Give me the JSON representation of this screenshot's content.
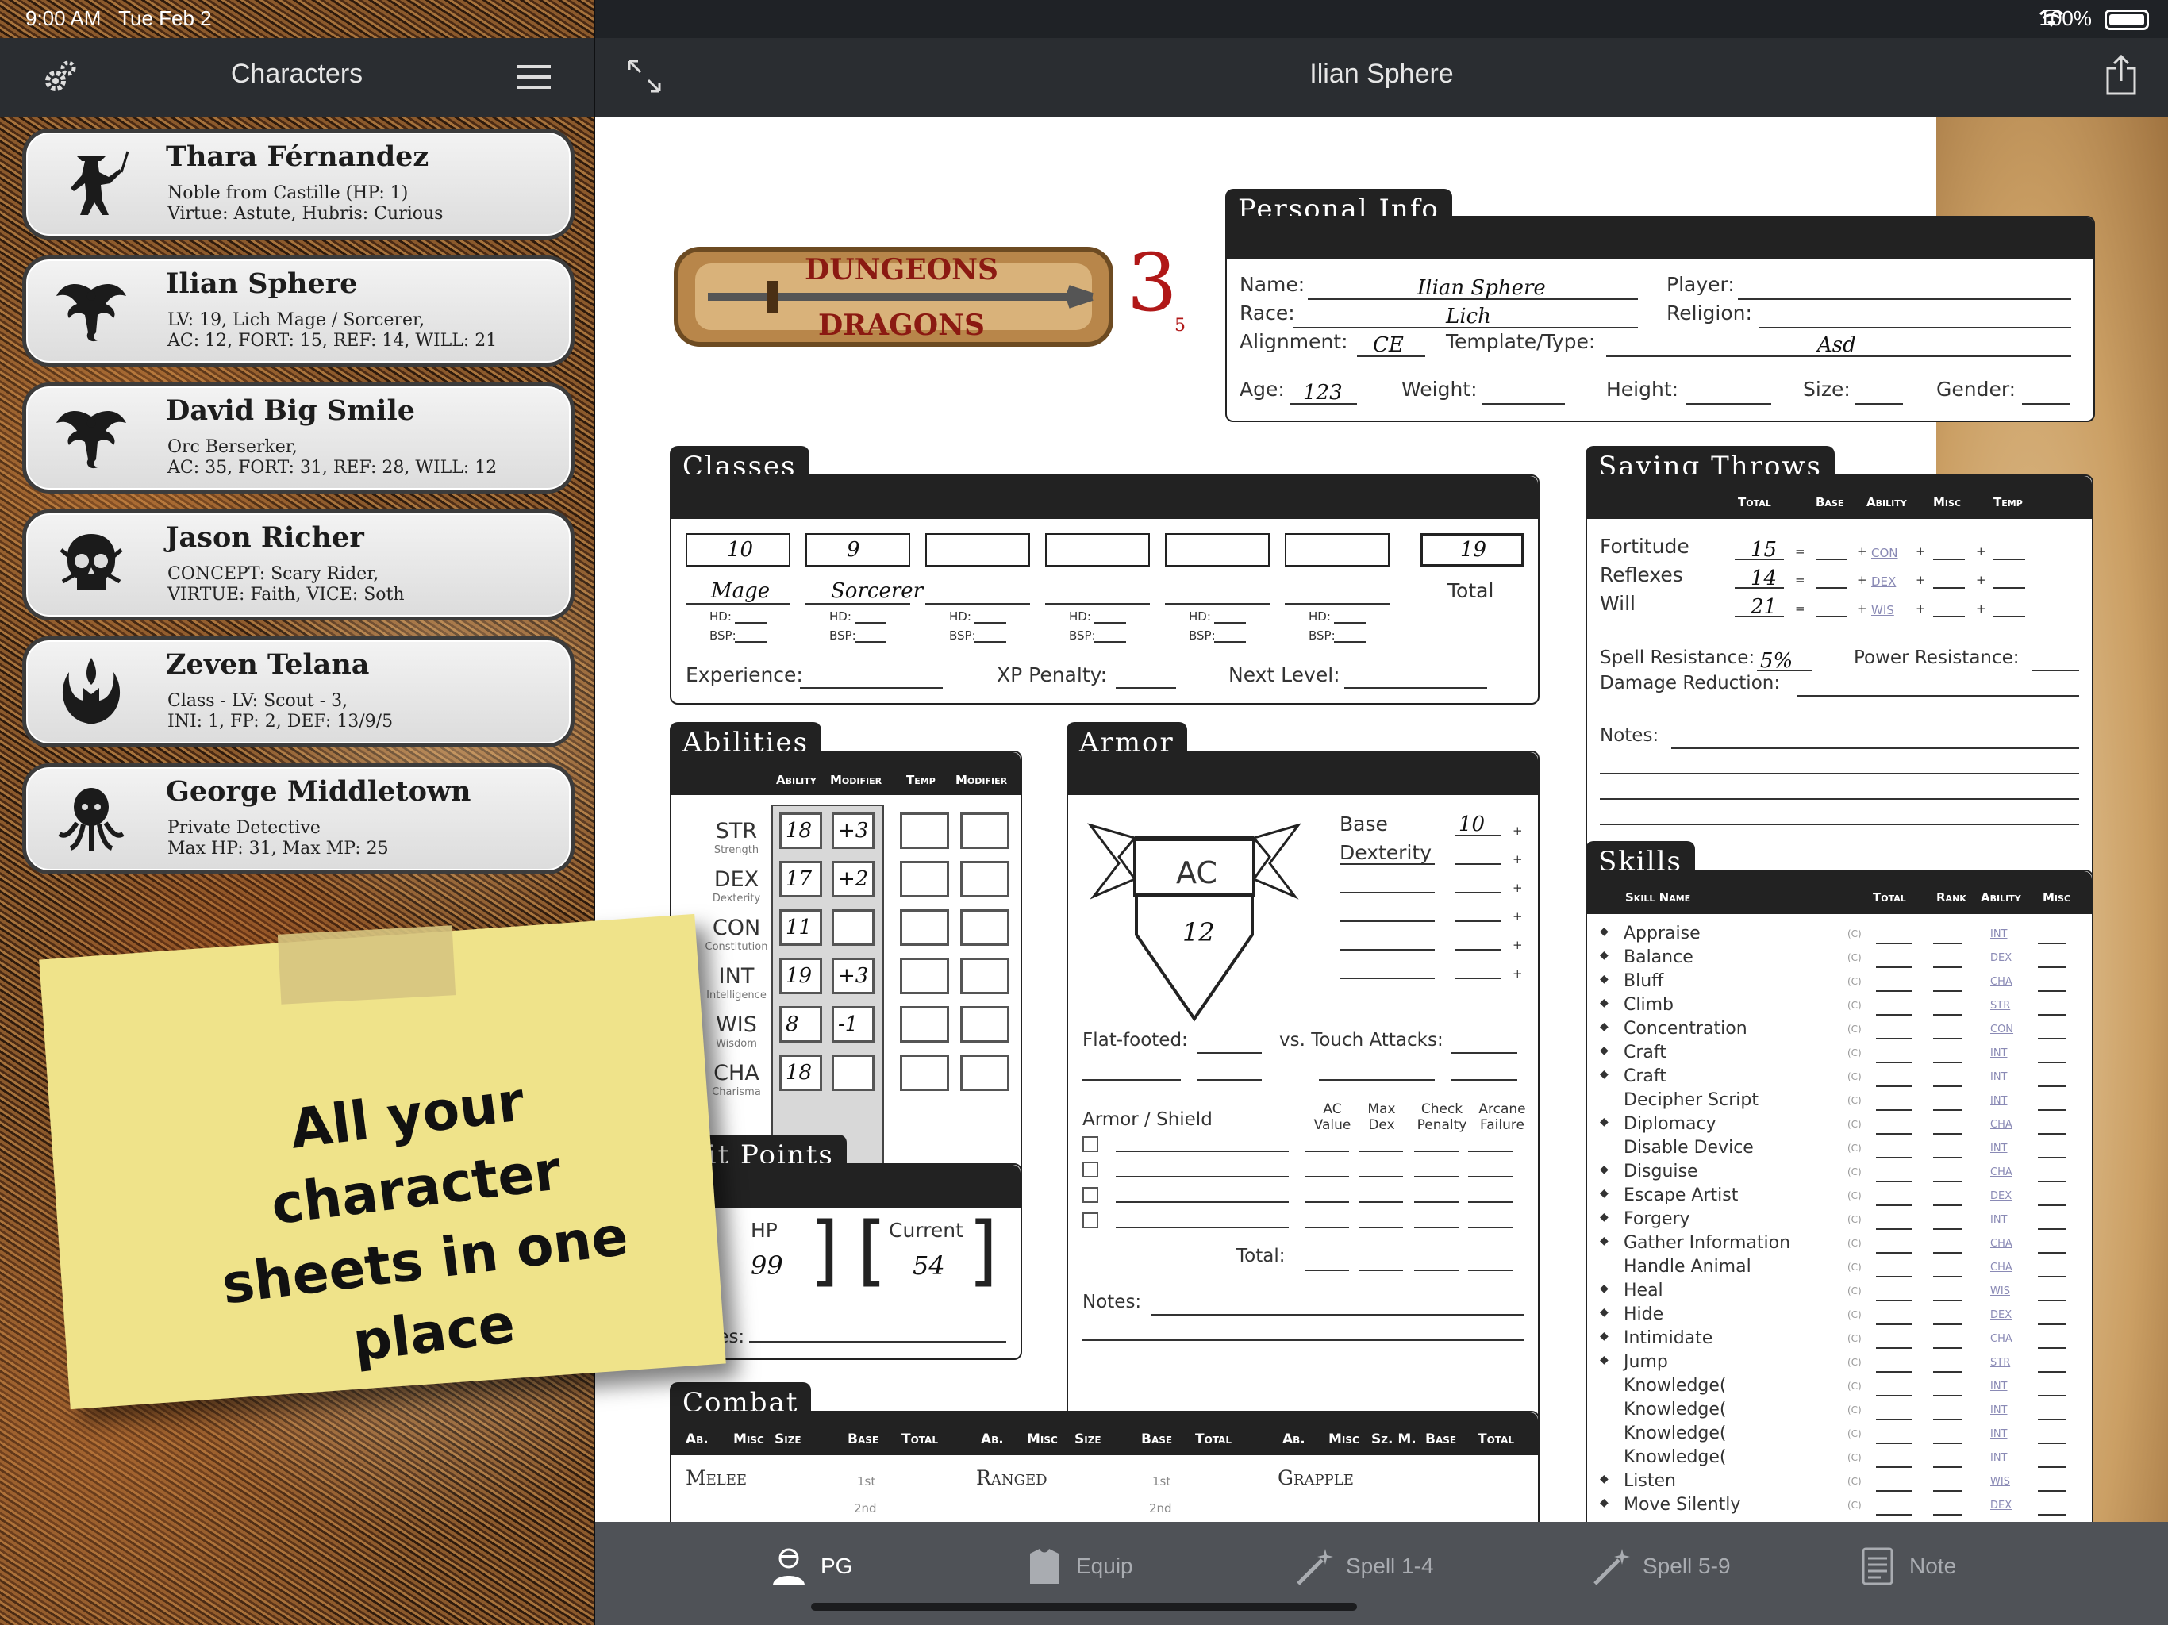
{
  "status_bar": {
    "time": "9:00 AM",
    "date": "Tue Feb 2",
    "battery": "100%"
  },
  "left_panel": {
    "title": "Characters",
    "characters": [
      {
        "name": "Thara Férnandez",
        "line1": "Noble from Castille (HP: 1)",
        "line2": "Virtue: Astute, Hubris: Curious",
        "icon": "swordsman-icon"
      },
      {
        "name": "Ilian Sphere",
        "line1": "LV: 19, Lich  Mage / Sorcerer,",
        "line2": "AC: 12, FORT: 15, REF: 14, WILL: 21",
        "icon": "dragon-icon"
      },
      {
        "name": "David Big Smile",
        "line1": "Orc  Berserker,",
        "line2": "AC: 35, FORT: 31, REF: 28, WILL: 12",
        "icon": "dragon-icon"
      },
      {
        "name": "Jason Richer",
        "line1": "CONCEPT: Scary Rider,",
        "line2": "VIRTUE: Faith, VICE: Soth",
        "icon": "skull-icon"
      },
      {
        "name": "Zeven Telana",
        "line1": "Class - LV: Scout - 3,",
        "line2": "INI: 1, FP: 2, DEF: 13/9/5",
        "icon": "rebel-icon"
      },
      {
        "name": "George Middletown",
        "line1": "Private Detective",
        "line2": "Max HP: 31, Max MP: 25",
        "icon": "cthulhu-icon"
      }
    ]
  },
  "sticky_note": {
    "line1": "All your character",
    "line2": "sheets in one place"
  },
  "right_panel": {
    "title": "Ilian Sphere"
  },
  "sheet": {
    "logo": {
      "line1": "DUNGEONS",
      "line2": "DRAGONS",
      "edition": "3",
      "edition_small": "5"
    },
    "personal_info": {
      "tab": "Personal Info",
      "name_label": "Name:",
      "name": "Ilian Sphere",
      "player_label": "Player:",
      "race_label": "Race:",
      "race": "Lich",
      "religion_label": "Religion:",
      "alignment_label": "Alignment:",
      "alignment": "CE",
      "template_label": "Template/Type:",
      "template": "Asd",
      "age_label": "Age:",
      "age": "123",
      "weight_label": "Weight:",
      "height_label": "Height:",
      "size_label": "Size:",
      "gender_label": "Gender:"
    },
    "classes": {
      "tab": "Classes",
      "levels": [
        "10",
        "9",
        "",
        "",
        "",
        ""
      ],
      "names": [
        "Mage",
        "Sorcerer",
        "",
        "",
        "",
        ""
      ],
      "hd_label": "HD:",
      "bsp_label": "BSP:",
      "total": "19",
      "total_label": "Total",
      "experience_label": "Experience:",
      "xp_penalty_label": "XP Penalty:",
      "next_level_label": "Next Level:"
    },
    "saving_throws": {
      "tab": "Saving Throws",
      "headers": [
        "Total",
        "Base",
        "Ability",
        "Misc",
        "Temp"
      ],
      "rows": [
        {
          "label": "Fortitude",
          "total": "15",
          "ability": "CON"
        },
        {
          "label": "Reflexes",
          "total": "14",
          "ability": "DEX"
        },
        {
          "label": "Will",
          "total": "21",
          "ability": "WIS"
        }
      ],
      "spell_res_label": "Spell Resistance:",
      "spell_res": "5%",
      "power_res_label": "Power Resistance:",
      "damage_red_label": "Damage Reduction:",
      "notes_label": "Notes:"
    },
    "abilities": {
      "tab": "Abilities",
      "headers": [
        "Ability",
        "Modifier",
        "Temp",
        "Modifier"
      ],
      "rows": [
        {
          "abbr": "STR",
          "full": "Strength",
          "score": "18",
          "mod": "+3"
        },
        {
          "abbr": "DEX",
          "full": "Dexterity",
          "score": "17",
          "mod": "+2"
        },
        {
          "abbr": "CON",
          "full": "Constitution",
          "score": "11",
          "mod": ""
        },
        {
          "abbr": "INT",
          "full": "Intelligence",
          "score": "19",
          "mod": "+3"
        },
        {
          "abbr": "WIS",
          "full": "Wisdom",
          "score": "8",
          "mod": "-1"
        },
        {
          "abbr": "CHA",
          "full": "Charisma",
          "score": "18",
          "mod": ""
        }
      ]
    },
    "armor": {
      "tab": "Armor",
      "ac_label": "AC",
      "ac": "12",
      "base_label": "Base",
      "base": "10",
      "dexterity_label": "Dexterity",
      "flat_footed_label": "Flat-footed:",
      "touch_label": "vs. Touch Attacks:",
      "armor_shield_label": "Armor / Shield",
      "col_headers": [
        "AC Value",
        "Max Dex",
        "Check Penalty",
        "Arcane Failure"
      ],
      "total_label": "Total:",
      "notes_label": "Notes:"
    },
    "hit_points": {
      "tab": "Hit Points",
      "hp_label": "HP",
      "hp": "99",
      "current_label": "Current",
      "current": "54",
      "notes_label": "Notes:"
    },
    "skills": {
      "tab": "Skills",
      "headers": [
        "Skill Name",
        "Total",
        "Rank",
        "Ability",
        "Misc"
      ],
      "rows": [
        {
          "name": "Appraise",
          "ab": "INT",
          "dot": true
        },
        {
          "name": "Balance",
          "ab": "DEX",
          "dot": true
        },
        {
          "name": "Bluff",
          "ab": "CHA",
          "dot": true
        },
        {
          "name": "Climb",
          "ab": "STR",
          "dot": true
        },
        {
          "name": "Concentration",
          "ab": "CON",
          "dot": true
        },
        {
          "name": "Craft",
          "ab": "INT",
          "dot": true
        },
        {
          "name": "Craft",
          "ab": "INT",
          "dot": true
        },
        {
          "name": "Decipher Script",
          "ab": "INT",
          "dot": false
        },
        {
          "name": "Diplomacy",
          "ab": "CHA",
          "dot": true
        },
        {
          "name": "Disable Device",
          "ab": "INT",
          "dot": false
        },
        {
          "name": "Disguise",
          "ab": "CHA",
          "dot": true
        },
        {
          "name": "Escape Artist",
          "ab": "DEX",
          "dot": true
        },
        {
          "name": "Forgery",
          "ab": "INT",
          "dot": true
        },
        {
          "name": "Gather Information",
          "ab": "CHA",
          "dot": true
        },
        {
          "name": "Handle Animal",
          "ab": "CHA",
          "dot": false
        },
        {
          "name": "Heal",
          "ab": "WIS",
          "dot": true
        },
        {
          "name": "Hide",
          "ab": "DEX",
          "dot": true
        },
        {
          "name": "Intimidate",
          "ab": "CHA",
          "dot": true
        },
        {
          "name": "Jump",
          "ab": "STR",
          "dot": true
        },
        {
          "name": "Knowledge(",
          "ab": "INT",
          "dot": false
        },
        {
          "name": "Knowledge(",
          "ab": "INT",
          "dot": false
        },
        {
          "name": "Knowledge(",
          "ab": "INT",
          "dot": false
        },
        {
          "name": "Knowledge(",
          "ab": "INT",
          "dot": false
        },
        {
          "name": "Listen",
          "ab": "WIS",
          "dot": true
        },
        {
          "name": "Move Silently",
          "ab": "DEX",
          "dot": true
        }
      ]
    },
    "combat": {
      "tab": "Combat",
      "headers": [
        "Ab.",
        "Misc",
        "Size",
        "Base",
        "Total",
        "Ab.",
        "Misc",
        "Size",
        "Base",
        "Total",
        "Ab.",
        "Misc",
        "Sz. M.",
        "Base",
        "Total"
      ],
      "melee": "Melee",
      "ranged": "Ranged",
      "grapple": "Grapple",
      "first": "1st",
      "second": "2nd"
    }
  },
  "tab_bar": [
    {
      "label": "PG",
      "icon": "person-icon",
      "active": true
    },
    {
      "label": "Equip",
      "icon": "armor-icon",
      "active": false
    },
    {
      "label": "Spell 1-4",
      "icon": "wand-icon",
      "active": false
    },
    {
      "label": "Spell 5-9",
      "icon": "wand-icon",
      "active": false
    },
    {
      "label": "Note",
      "icon": "note-icon",
      "active": false
    }
  ]
}
